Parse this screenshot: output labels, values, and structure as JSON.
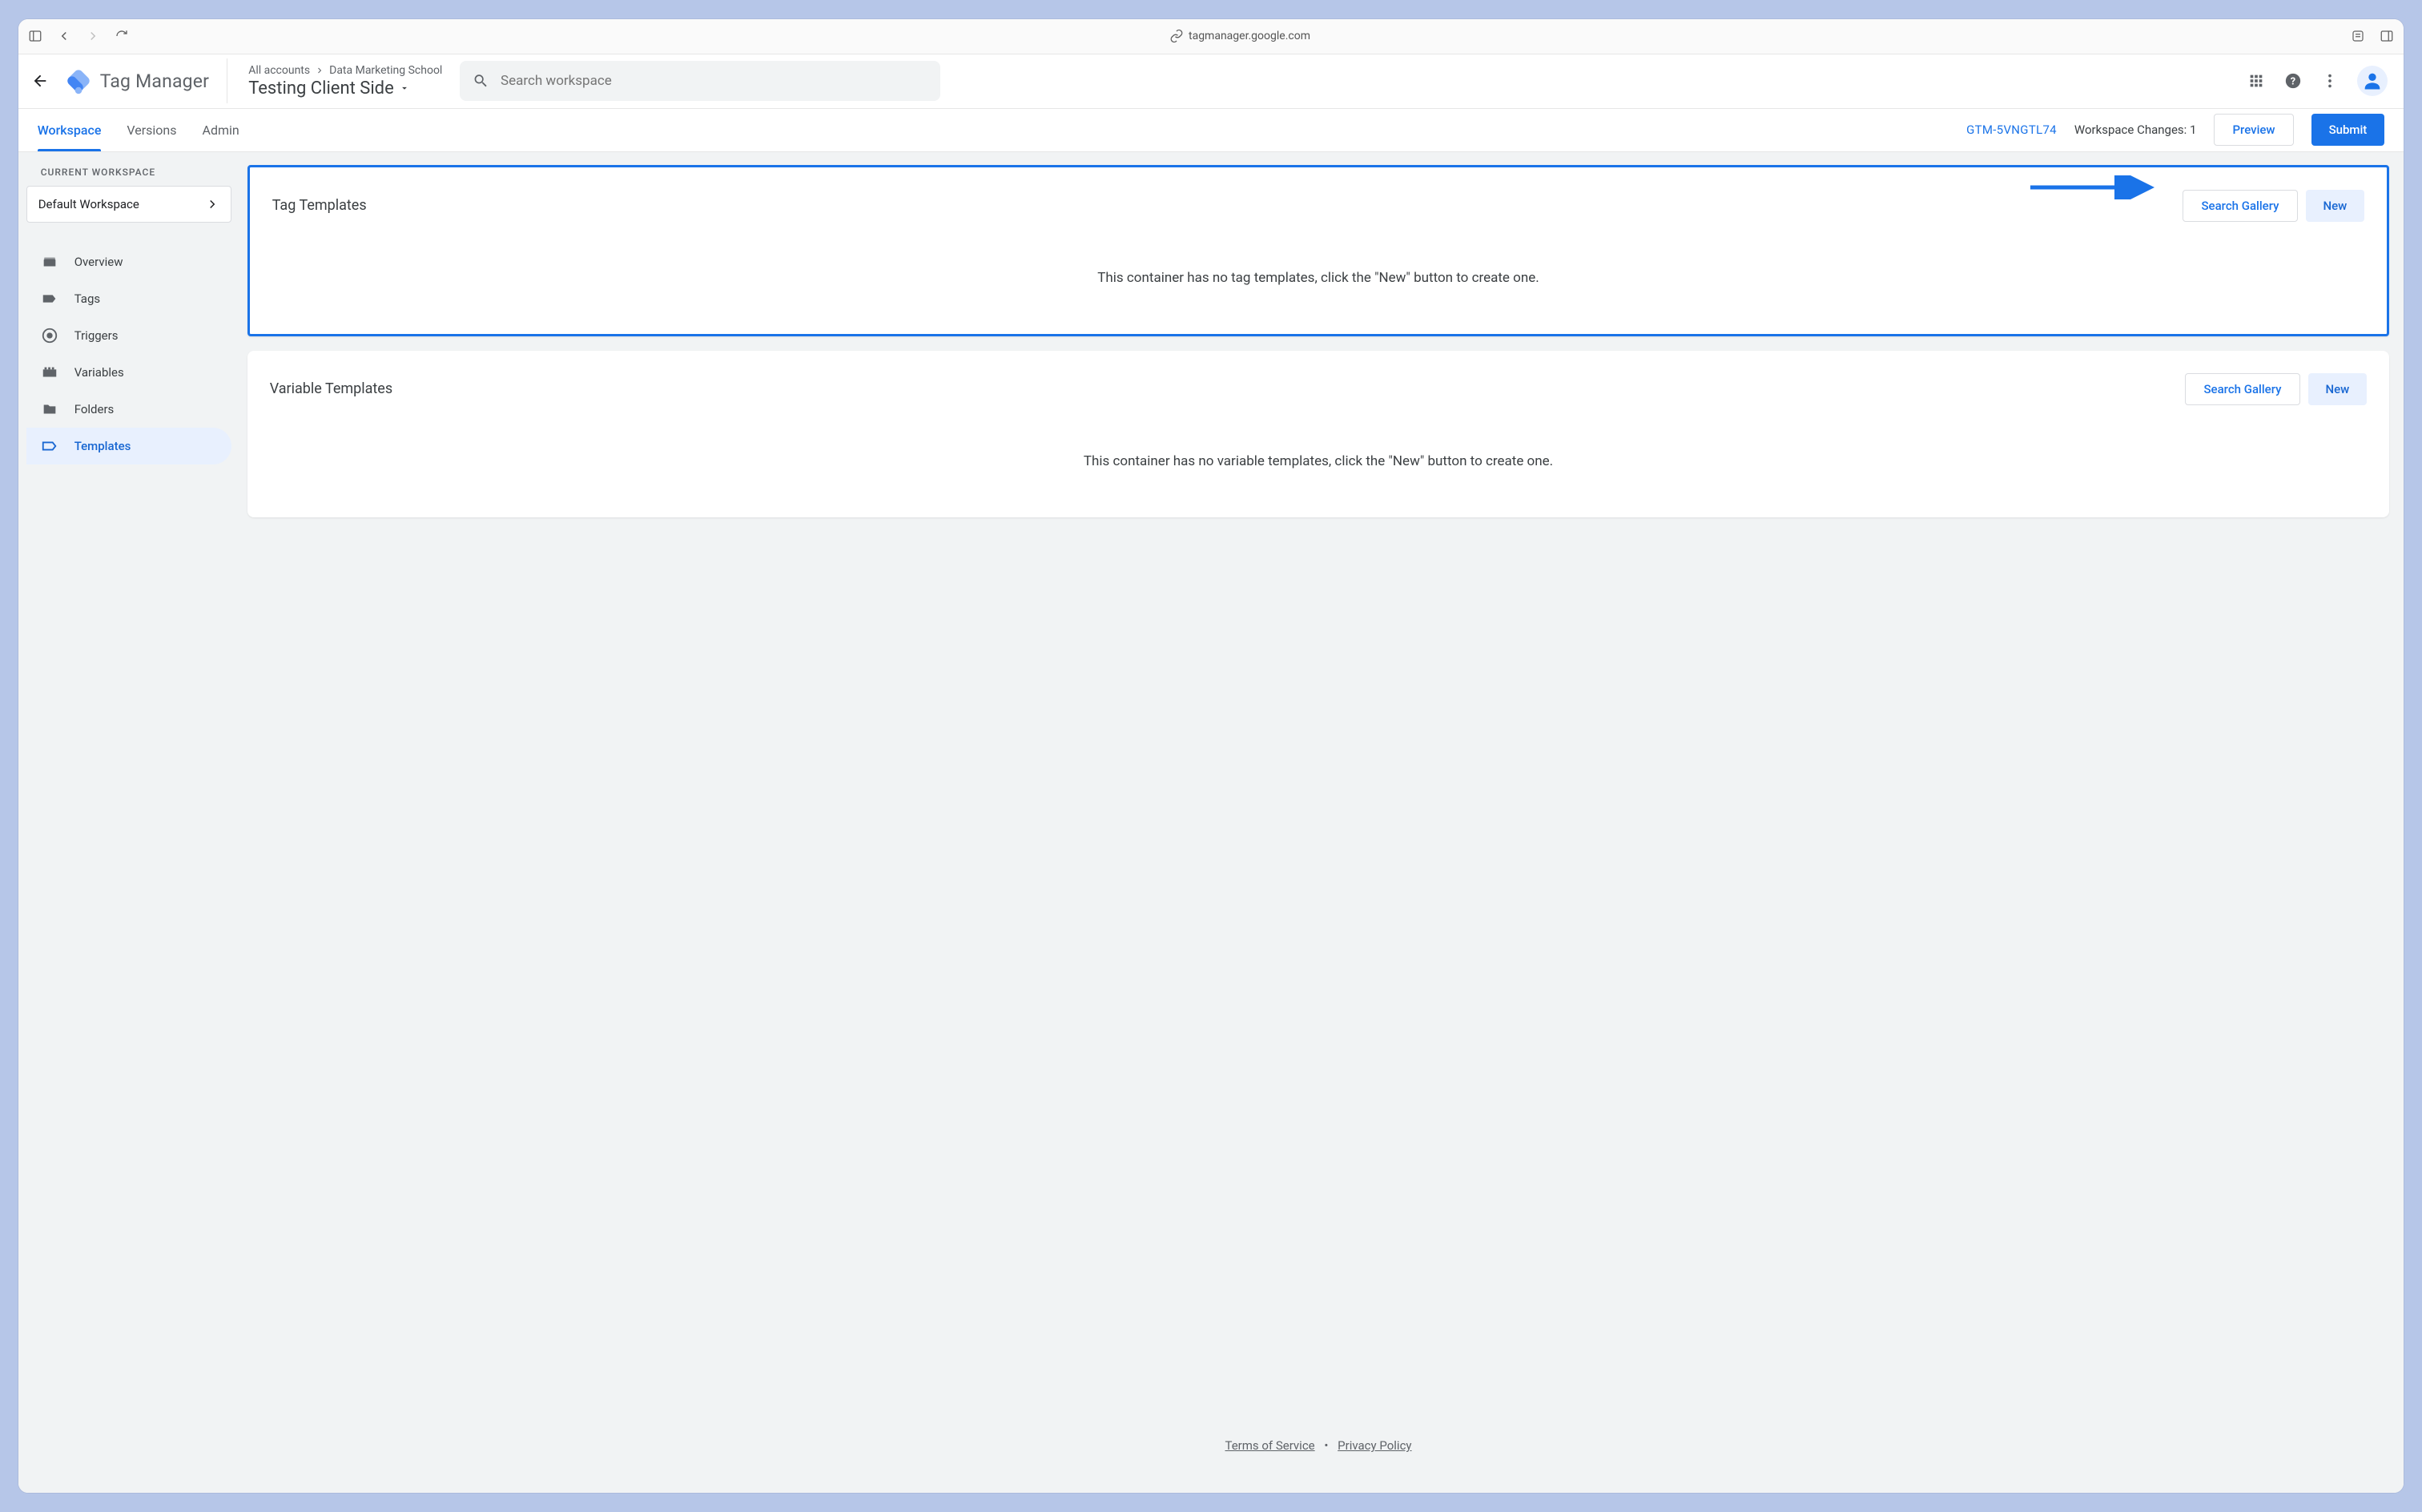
{
  "browser": {
    "url": "tagmanager.google.com"
  },
  "header": {
    "product": "Tag Manager",
    "breadcrumb": {
      "root": "All accounts",
      "account": "Data Marketing School"
    },
    "container": "Testing Client Side",
    "search_placeholder": "Search workspace"
  },
  "subheader": {
    "tabs": {
      "workspace": "Workspace",
      "versions": "Versions",
      "admin": "Admin"
    },
    "container_id": "GTM-5VNGTL74",
    "changes_label": "Workspace Changes: 1",
    "preview": "Preview",
    "submit": "Submit"
  },
  "sidebar": {
    "label": "CURRENT WORKSPACE",
    "workspace": "Default Workspace",
    "items": {
      "overview": "Overview",
      "tags": "Tags",
      "triggers": "Triggers",
      "variables": "Variables",
      "folders": "Folders",
      "templates": "Templates"
    }
  },
  "cards": {
    "tag": {
      "title": "Tag Templates",
      "search": "Search Gallery",
      "new": "New",
      "empty": "This container has no tag templates, click the \"New\" button to create one."
    },
    "var": {
      "title": "Variable Templates",
      "search": "Search Gallery",
      "new": "New",
      "empty": "This container has no variable templates, click the \"New\" button to create one."
    }
  },
  "footer": {
    "terms": "Terms of Service",
    "privacy": "Privacy Policy"
  }
}
